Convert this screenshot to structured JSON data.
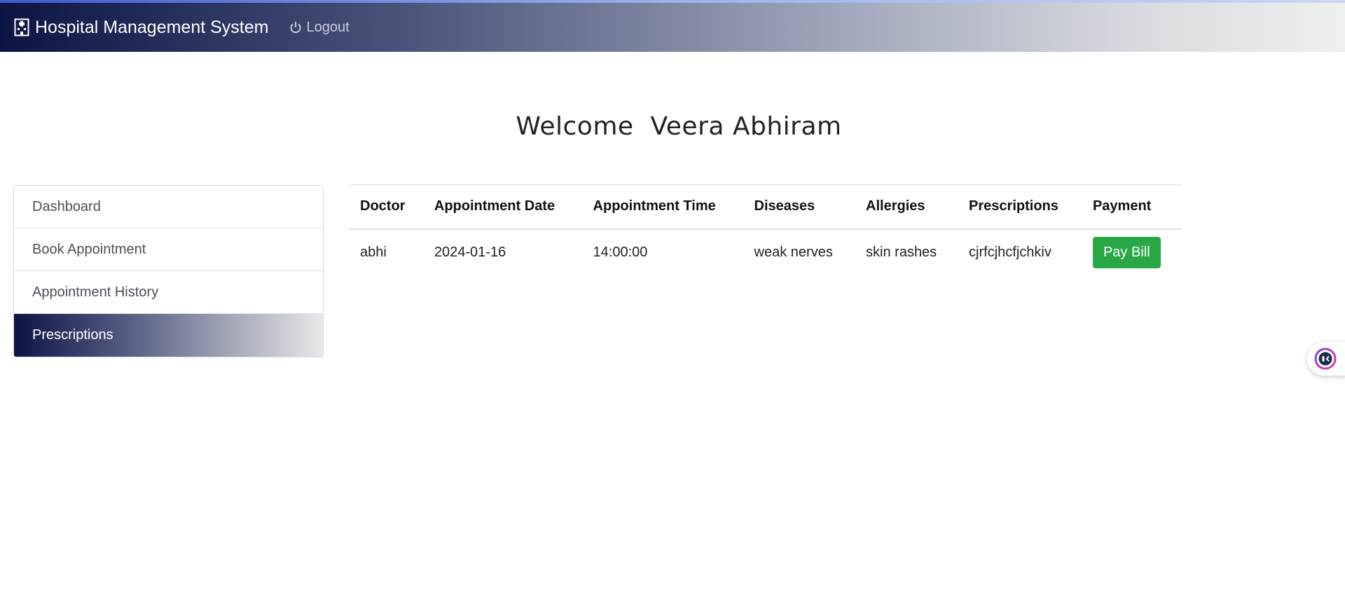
{
  "navbar": {
    "brand": "Hospital Management System",
    "logout_label": "Logout"
  },
  "welcome": {
    "greeting": "Welcome",
    "user_name": "Veera Abhiram"
  },
  "sidebar": {
    "items": [
      {
        "label": "Dashboard",
        "active": false
      },
      {
        "label": "Book Appointment",
        "active": false
      },
      {
        "label": "Appointment History",
        "active": false
      },
      {
        "label": "Prescriptions",
        "active": true
      }
    ]
  },
  "table": {
    "headers": [
      "Doctor",
      "Appointment Date",
      "Appointment Time",
      "Diseases",
      "Allergies",
      "Prescriptions",
      "Payment"
    ],
    "rows": [
      {
        "doctor": "abhi",
        "date": "2024-01-16",
        "time": "14:00:00",
        "diseases": "weak nerves",
        "allergies": "skin rashes",
        "prescription": "cjrfcjhcfjchkiv",
        "payment_button": "Pay Bill"
      }
    ]
  },
  "icons": {
    "brand_icon": "hospital-icon",
    "logout_icon": "power-icon",
    "assistant_icon": "assistant-icon"
  },
  "colors": {
    "nav_dark": "#0c1444",
    "pay_button": "#28a745"
  }
}
